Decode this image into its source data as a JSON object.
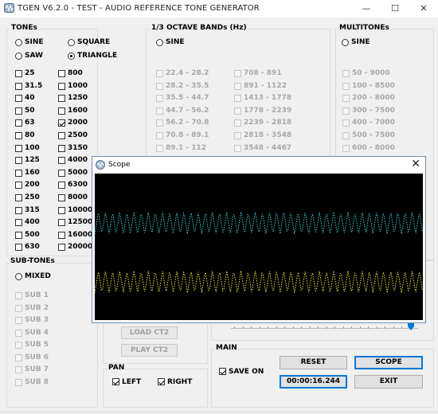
{
  "window": {
    "title": "TGEN V6.2.0 - TEST - AUDIO REFERENCE TONE GENERATOR",
    "minimize_icon": "minimize-icon",
    "maximize_icon": "maximize-icon",
    "close_icon": "close-icon"
  },
  "tones": {
    "label": "TONEs",
    "waveforms": [
      {
        "label": "SINE",
        "selected": false
      },
      {
        "label": "SQUARE",
        "selected": false
      },
      {
        "label": "SAW",
        "selected": false
      },
      {
        "label": "TRIANGLE",
        "selected": true
      }
    ],
    "col1": [
      {
        "label": "25",
        "checked": false
      },
      {
        "label": "31.5",
        "checked": false
      },
      {
        "label": "40",
        "checked": false
      },
      {
        "label": "50",
        "checked": false
      },
      {
        "label": "63",
        "checked": false
      },
      {
        "label": "80",
        "checked": false
      },
      {
        "label": "100",
        "checked": false
      },
      {
        "label": "125",
        "checked": false
      },
      {
        "label": "160",
        "checked": false
      },
      {
        "label": "200",
        "checked": false
      },
      {
        "label": "250",
        "checked": false
      },
      {
        "label": "315",
        "checked": false
      },
      {
        "label": "400",
        "checked": false
      },
      {
        "label": "500",
        "checked": false
      },
      {
        "label": "630",
        "checked": false
      }
    ],
    "col2": [
      {
        "label": "800",
        "checked": false
      },
      {
        "label": "1000",
        "checked": false
      },
      {
        "label": "1250",
        "checked": false
      },
      {
        "label": "1600",
        "checked": false
      },
      {
        "label": "2000",
        "checked": true
      },
      {
        "label": "2500",
        "checked": false
      },
      {
        "label": "3150",
        "checked": false
      },
      {
        "label": "4000",
        "checked": false
      },
      {
        "label": "5000",
        "checked": false
      },
      {
        "label": "6300",
        "checked": false
      },
      {
        "label": "8000",
        "checked": false
      },
      {
        "label": "10000",
        "checked": false
      },
      {
        "label": "12500",
        "checked": false
      },
      {
        "label": "16000",
        "checked": false
      },
      {
        "label": "20000",
        "checked": false
      }
    ]
  },
  "octave": {
    "label": "1/3 OCTAVE BANDs (Hz)",
    "sine_label": "SINE",
    "col1": [
      "22.4 - 28.2",
      "28.2 - 35.5",
      "35.5 - 44.7",
      "44.7 - 56.2",
      "56.2 - 70.8",
      "70.8 - 89.1",
      "89.1 - 112"
    ],
    "col2": [
      "708 - 891",
      "891 - 1122",
      "1413 - 1778",
      "1778 - 2239",
      "2239 - 2818",
      "2818 - 3548",
      "3548 - 4467"
    ]
  },
  "multitones": {
    "label": "MULTITONEs",
    "sine_label": "SINE",
    "items": [
      "50 - 9000",
      "100 - 8500",
      "200 - 8000",
      "300 - 7500",
      "400 - 7000",
      "500 - 7500",
      "600 - 8000"
    ]
  },
  "subtones": {
    "label": "SUB-TONEs",
    "mixed_label": "MIXED",
    "items": [
      "SUB 1",
      "SUB 2",
      "SUB 3",
      "SUB 4",
      "SUB 5",
      "SUB 6",
      "SUB 7",
      "SUB 8"
    ]
  },
  "ct2": {
    "load_label": "LOAD CT2",
    "play_label": "PLAY CT2"
  },
  "pan": {
    "label": "PAN",
    "left_label": "LEFT",
    "left_checked": true,
    "right_label": "RIGHT",
    "right_checked": true
  },
  "main": {
    "label": "MAIN",
    "save_on_label": "SAVE ON",
    "save_on_checked": true,
    "reset_label": "RESET",
    "scope_label": "SCOPE",
    "time_display": "00:00:16.244",
    "exit_label": "EXIT"
  },
  "scope": {
    "title": "Scope",
    "close_icon": "close-icon",
    "channel_colors": {
      "left": "#33cccc",
      "right": "#e6e633"
    },
    "waveform": "triangle",
    "cycles_visible": 46
  }
}
